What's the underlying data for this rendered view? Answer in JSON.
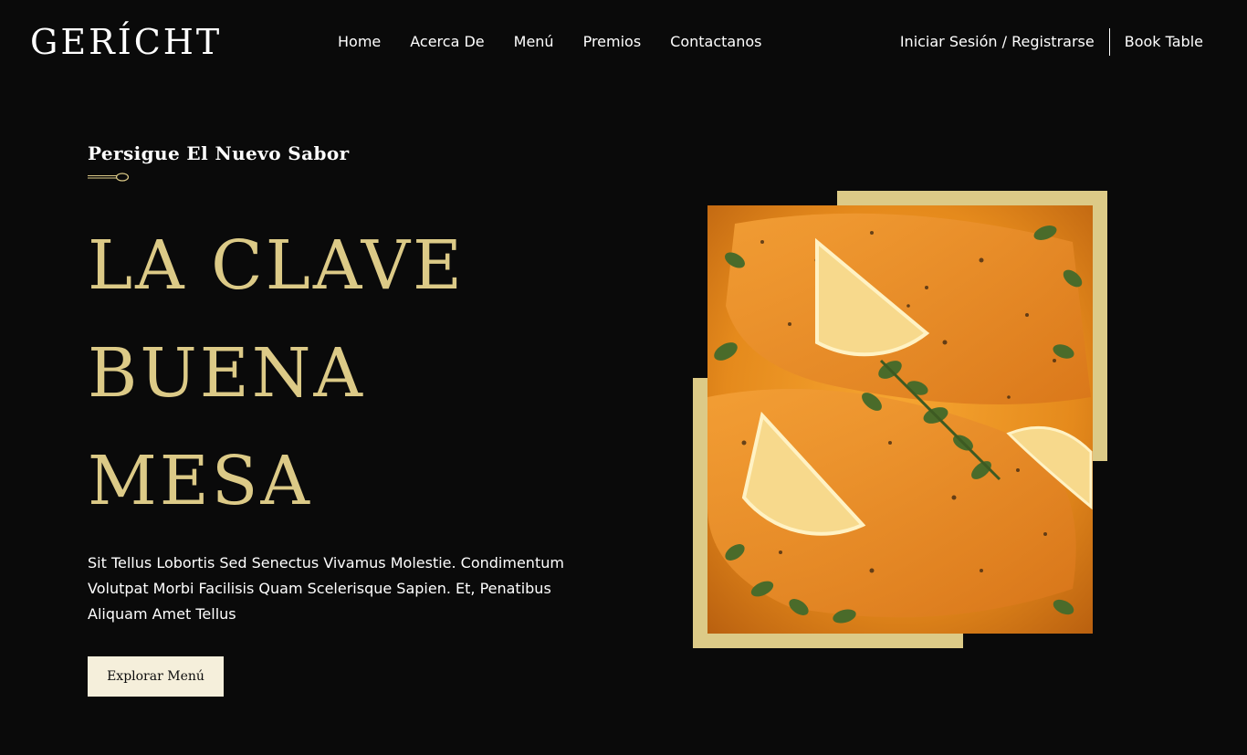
{
  "header": {
    "logo": "GERÍCHT",
    "nav": [
      "Home",
      "Acerca De",
      "Menú",
      "Premios",
      "Contactanos"
    ],
    "login_label": "Iniciar Sesión / Registrarse",
    "book_label": "Book Table"
  },
  "hero": {
    "tagline": "Persigue El Nuevo Sabor",
    "headline": [
      "LA CLAVE",
      "BUENA",
      "MESA"
    ],
    "description": "Sit Tellus Lobortis Sed Senectus Vivamus Molestie. Condimentum Volutpat Morbi Facilisis Quam Scelerisque Sapien. Et, Penatibus Aliquam Amet Tellus",
    "cta_label": "Explorar Menú"
  },
  "colors": {
    "background": "#0a0a0a",
    "accent_gold": "#dcca87",
    "button_bg": "#f5efdb",
    "text": "#ffffff"
  }
}
